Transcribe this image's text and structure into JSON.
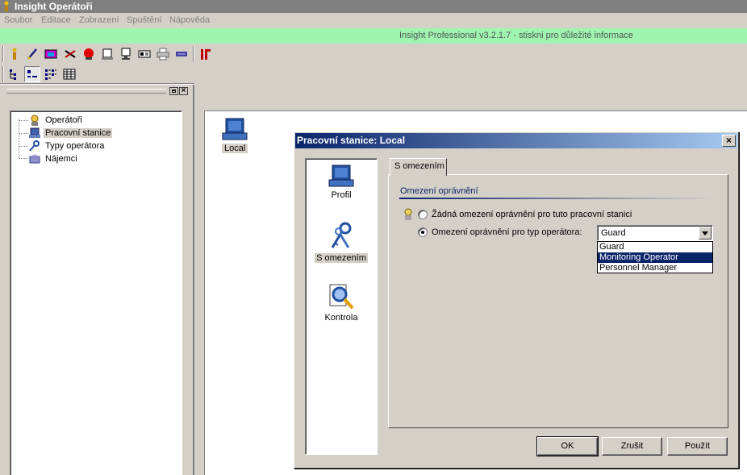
{
  "window": {
    "title": "Insight Operátoři"
  },
  "menu": [
    "Soubor",
    "Editace",
    "Zobrazení",
    "Spuštění",
    "Nápověda"
  ],
  "infobar": "Insight Professional v3.2.1.7 - stiskni pro důležité informace",
  "toolbar1": [
    "person-icon",
    "pen-icon",
    "window-icon",
    "tools-icon",
    "alarm-icon",
    "scanner-icon",
    "monitor-icon",
    "card-icon",
    "printer-icon",
    "bar-icon",
    "logo-icon"
  ],
  "toolbar2": [
    "tree-view-icon",
    "small-icons-icon",
    "list-view-icon",
    "details-view-icon"
  ],
  "tree": {
    "items": [
      {
        "label": "Operátoři",
        "icon": "operator-icon"
      },
      {
        "label": "Pracovní stanice",
        "icon": "workstation-icon",
        "selected": true
      },
      {
        "label": "Typy operátora",
        "icon": "operator-type-icon"
      },
      {
        "label": "Nájemci",
        "icon": "tenant-icon"
      }
    ]
  },
  "main": {
    "item_label": "Local"
  },
  "dialog": {
    "title": "Pracovní stanice: Local",
    "sidebar": [
      {
        "label": "Profil",
        "icon": "workstation-icon"
      },
      {
        "label": "S omezením",
        "icon": "keys-icon",
        "active": true
      },
      {
        "label": "Kontrola",
        "icon": "magnifier-icon"
      }
    ],
    "tab_label": "S omezením",
    "section_label": "Omezení oprávnění",
    "radio_none": "Žádná omezení oprávnění pro tuto pracovní stanici",
    "radio_type": "Omezení oprávnění pro typ operátora:",
    "combo_value": "Guard",
    "options": [
      "Guard",
      "Monitoring Operator",
      "Personnel Manager"
    ],
    "highlighted_option": "Monitoring Operator",
    "buttons": {
      "ok": "OK",
      "cancel": "Zrušit",
      "apply": "Použít"
    }
  }
}
